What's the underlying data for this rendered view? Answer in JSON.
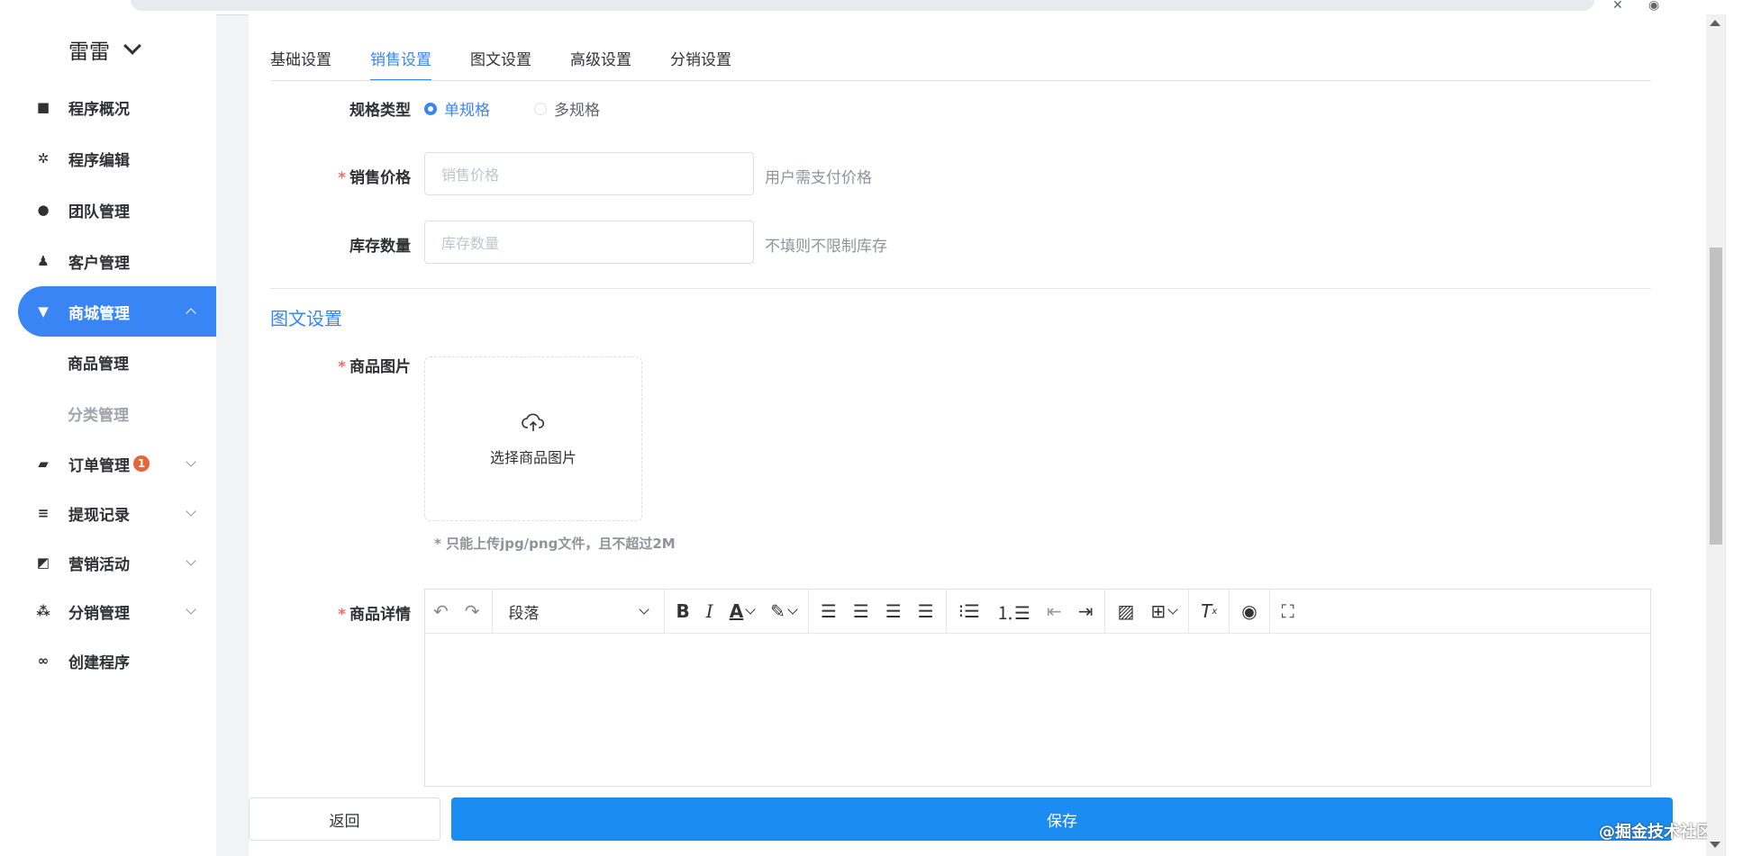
{
  "sidebar": {
    "brand": "雷雷",
    "items": [
      {
        "label": "程序概况",
        "icon": "folder-icon",
        "glyph": "■"
      },
      {
        "label": "程序编辑",
        "icon": "gear-icon",
        "glyph": "✲"
      },
      {
        "label": "团队管理",
        "icon": "team-icon",
        "glyph": "●"
      },
      {
        "label": "客户管理",
        "icon": "user-icon",
        "glyph": "♟"
      },
      {
        "label": "商城管理",
        "icon": "cart-icon",
        "glyph": "🛒"
      },
      {
        "label": "订单管理",
        "icon": "wallet-icon",
        "glyph": "▰",
        "badge": "1"
      },
      {
        "label": "提现记录",
        "icon": "coins-icon",
        "glyph": "≡"
      },
      {
        "label": "营销活动",
        "icon": "chart-icon",
        "glyph": "◩"
      },
      {
        "label": "分销管理",
        "icon": "network-icon",
        "glyph": "⁂"
      },
      {
        "label": "创建程序",
        "icon": "link-icon",
        "glyph": "∞"
      }
    ],
    "sub_items": [
      "商品管理",
      "分类管理"
    ]
  },
  "tabs": [
    "基础设置",
    "销售设置",
    "图文设置",
    "高级设置",
    "分销设置"
  ],
  "form": {
    "spec_type": {
      "label": "规格类型",
      "options": [
        "单规格",
        "多规格"
      ],
      "selected": "单规格"
    },
    "price": {
      "label": "销售价格",
      "placeholder": "销售价格",
      "hint": "用户需支付价格"
    },
    "stock": {
      "label": "库存数量",
      "placeholder": "库存数量",
      "hint": "不填则不限制库存"
    },
    "section_title": "图文设置",
    "image": {
      "label": "商品图片",
      "upload_text": "选择商品图片",
      "tip": "* 只能上传jpg/png文件，且不超过2M"
    },
    "detail": {
      "label": "商品详情",
      "paragraph": "段落"
    }
  },
  "buttons": {
    "back": "返回",
    "save": "保存"
  },
  "watermark": "@掘金技术社区",
  "colors": {
    "accent": "#3a85f5",
    "save": "#1a8cf2",
    "required": "#f56c6c",
    "badge": "#e6663a"
  }
}
